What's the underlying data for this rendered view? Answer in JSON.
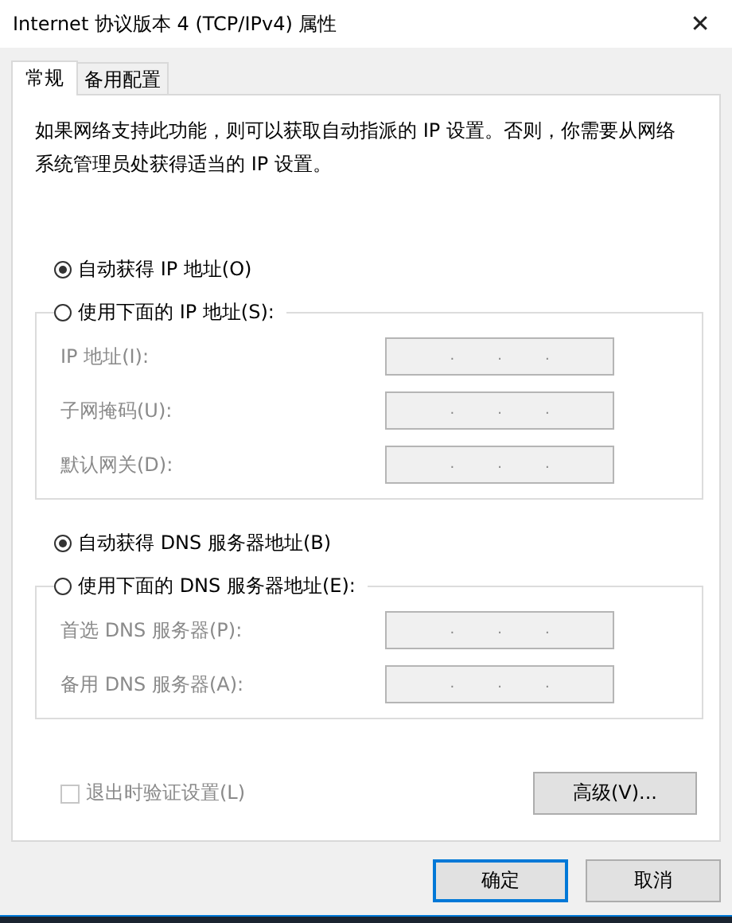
{
  "window": {
    "title": "Internet 协议版本 4 (TCP/IPv4) 属性",
    "close": "✕"
  },
  "tabs": [
    {
      "label": "常规",
      "selected": true
    },
    {
      "label": "备用配置",
      "selected": false
    }
  ],
  "description": "如果网络支持此功能，则可以获取自动指派的 IP 设置。否则，你需要从网络系统管理员处获得适当的 IP 设置。",
  "sections": [
    {
      "options": [
        {
          "label": "自动获得 IP 地址(O)",
          "selected": true
        },
        {
          "label": "使用下面的 IP 地址(S):",
          "selected": false
        }
      ],
      "fields": [
        {
          "label": "IP 地址(I):",
          "disabled": true,
          "separators": [
            ".",
            ".",
            "."
          ]
        },
        {
          "label": "子网掩码(U):",
          "disabled": true,
          "separators": [
            ".",
            ".",
            "."
          ]
        },
        {
          "label": "默认网关(D):",
          "disabled": true,
          "separators": [
            ".",
            ".",
            "."
          ]
        }
      ]
    },
    {
      "options": [
        {
          "label": "自动获得 DNS 服务器地址(B)",
          "selected": true
        },
        {
          "label": "使用下面的 DNS 服务器地址(E):",
          "selected": false
        }
      ],
      "fields": [
        {
          "label": "首选 DNS 服务器(P):",
          "disabled": true,
          "separators": [
            ".",
            ".",
            "."
          ]
        },
        {
          "label": "备用 DNS 服务器(A):",
          "disabled": true,
          "separators": [
            ".",
            ".",
            "."
          ]
        }
      ]
    }
  ],
  "validate_checkbox": {
    "label": "退出时验证设置(L)",
    "checked": false,
    "disabled": true
  },
  "advanced_button": "高级(V)...",
  "buttons": [
    {
      "label": "确定",
      "default": true
    },
    {
      "label": "取消",
      "default": false
    }
  ]
}
